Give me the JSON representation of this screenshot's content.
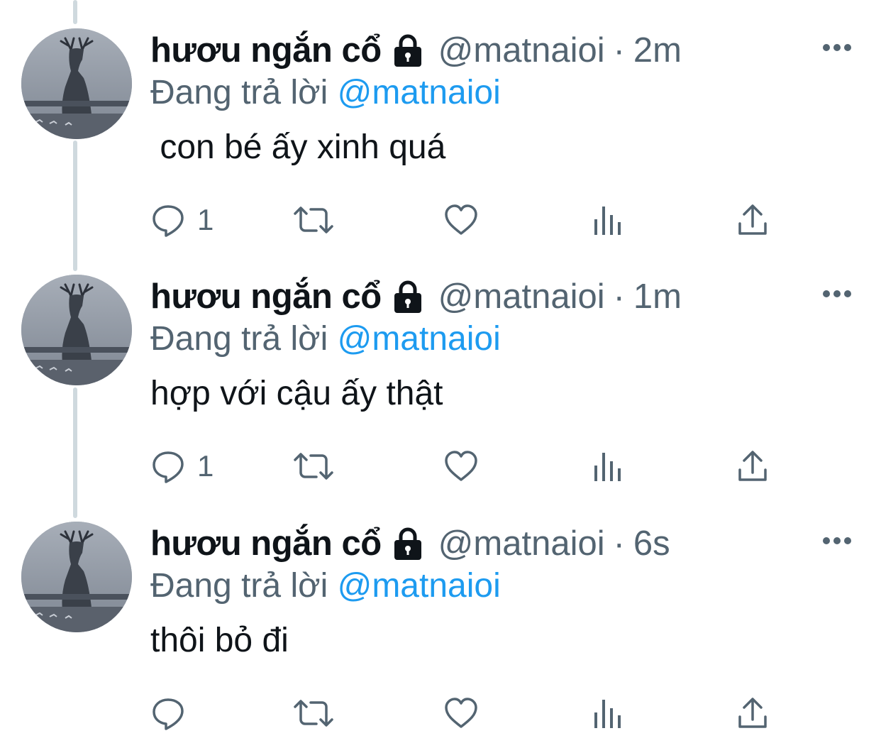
{
  "tweets": [
    {
      "display_name": "hươu ngắn cổ",
      "handle": "@matnaioi",
      "separator": "·",
      "time": "2m",
      "reply_prefix": "Đang trả lời",
      "reply_to": "@matnaioi",
      "text": " con bé ấy xinh quá",
      "reply_count": "1"
    },
    {
      "display_name": "hươu ngắn cổ",
      "handle": "@matnaioi",
      "separator": "·",
      "time": "1m",
      "reply_prefix": "Đang trả lời",
      "reply_to": "@matnaioi",
      "text": "hợp với cậu ấy thật",
      "reply_count": "1"
    },
    {
      "display_name": "hươu ngắn cổ",
      "handle": "@matnaioi",
      "separator": "·",
      "time": "6s",
      "reply_prefix": "Đang trả lời",
      "reply_to": "@matnaioi",
      "text": "thôi bỏ đi",
      "reply_count": ""
    }
  ],
  "icons": {
    "protected": "lock-icon",
    "more": "more-icon",
    "reply": "reply-icon",
    "retweet": "retweet-icon",
    "like": "heart-icon",
    "views": "analytics-icon",
    "share": "share-icon"
  },
  "colors": {
    "text": "#0f1419",
    "secondary": "#536471",
    "mention": "#1d9bf0",
    "thread_line": "#cfd9de"
  }
}
